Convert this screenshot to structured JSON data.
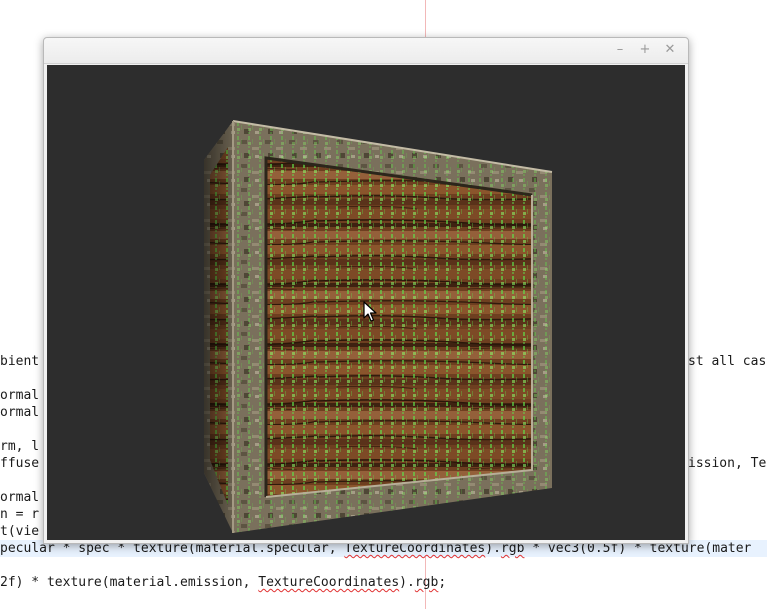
{
  "editor": {
    "lines": [
      {
        "left": "bient",
        "right": "st all cas"
      },
      {
        "left": "ormal",
        "right": ""
      },
      {
        "left": "ormal",
        "right": ""
      },
      {
        "left": "rm, l",
        "right": ""
      },
      {
        "left": "ffuse",
        "right": "ission, Te"
      },
      {
        "left": "ormal",
        "right": ""
      },
      {
        "left": "n = r",
        "right": ""
      },
      {
        "left": "t(vie",
        "right": ""
      },
      {
        "left": "pecular * spec * texture(material.specular, TextureCoordinates).rgb * vec3(0.5f) * texture(mater",
        "right": ""
      },
      {
        "left": "2f) * texture(material.emission, TextureCoordinates).rgb;",
        "right": ""
      }
    ]
  },
  "window": {
    "title": "",
    "minimize_glyph": "–",
    "maximize_glyph": "+",
    "close_glyph": "✕"
  },
  "scene": {
    "background_color": "#2d2d2d",
    "object": "wooden-crate-cube-with-green-matrix-emission-texture",
    "frame_color": "#7a705c",
    "plank_color": "#6e3f20",
    "emission_color": "#5fdc4a"
  },
  "cursor": {
    "icon": "arrow-pointer-icon"
  }
}
